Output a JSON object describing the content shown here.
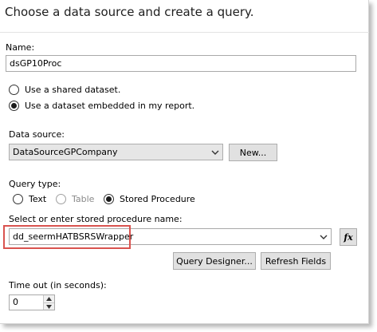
{
  "heading": "Choose a data source and create a query.",
  "name": {
    "label": "Name:",
    "value": "dsGP10Proc"
  },
  "dataset_options": [
    {
      "label": "Use a shared dataset.",
      "checked": false
    },
    {
      "label": "Use a dataset embedded in my report.",
      "checked": true
    }
  ],
  "data_source": {
    "label": "Data source:",
    "value": "DataSourceGPCompany",
    "new_button": "New..."
  },
  "query_type": {
    "label": "Query type:",
    "options": [
      {
        "label": "Text",
        "checked": false,
        "disabled": false
      },
      {
        "label": "Table",
        "checked": false,
        "disabled": true
      },
      {
        "label": "Stored Procedure",
        "checked": true,
        "disabled": false
      }
    ]
  },
  "stored_procedure": {
    "label": "Select or enter stored procedure name:",
    "value": "dd_seermHATBSRSWrapper",
    "expression_button": "fx"
  },
  "buttons": {
    "query_designer": "Query Designer...",
    "refresh_fields": "Refresh Fields"
  },
  "timeout": {
    "label": "Time out (in seconds):",
    "value": "0"
  },
  "colors": {
    "highlight": "#d9534f",
    "panel_border": "#d6d6d6"
  }
}
